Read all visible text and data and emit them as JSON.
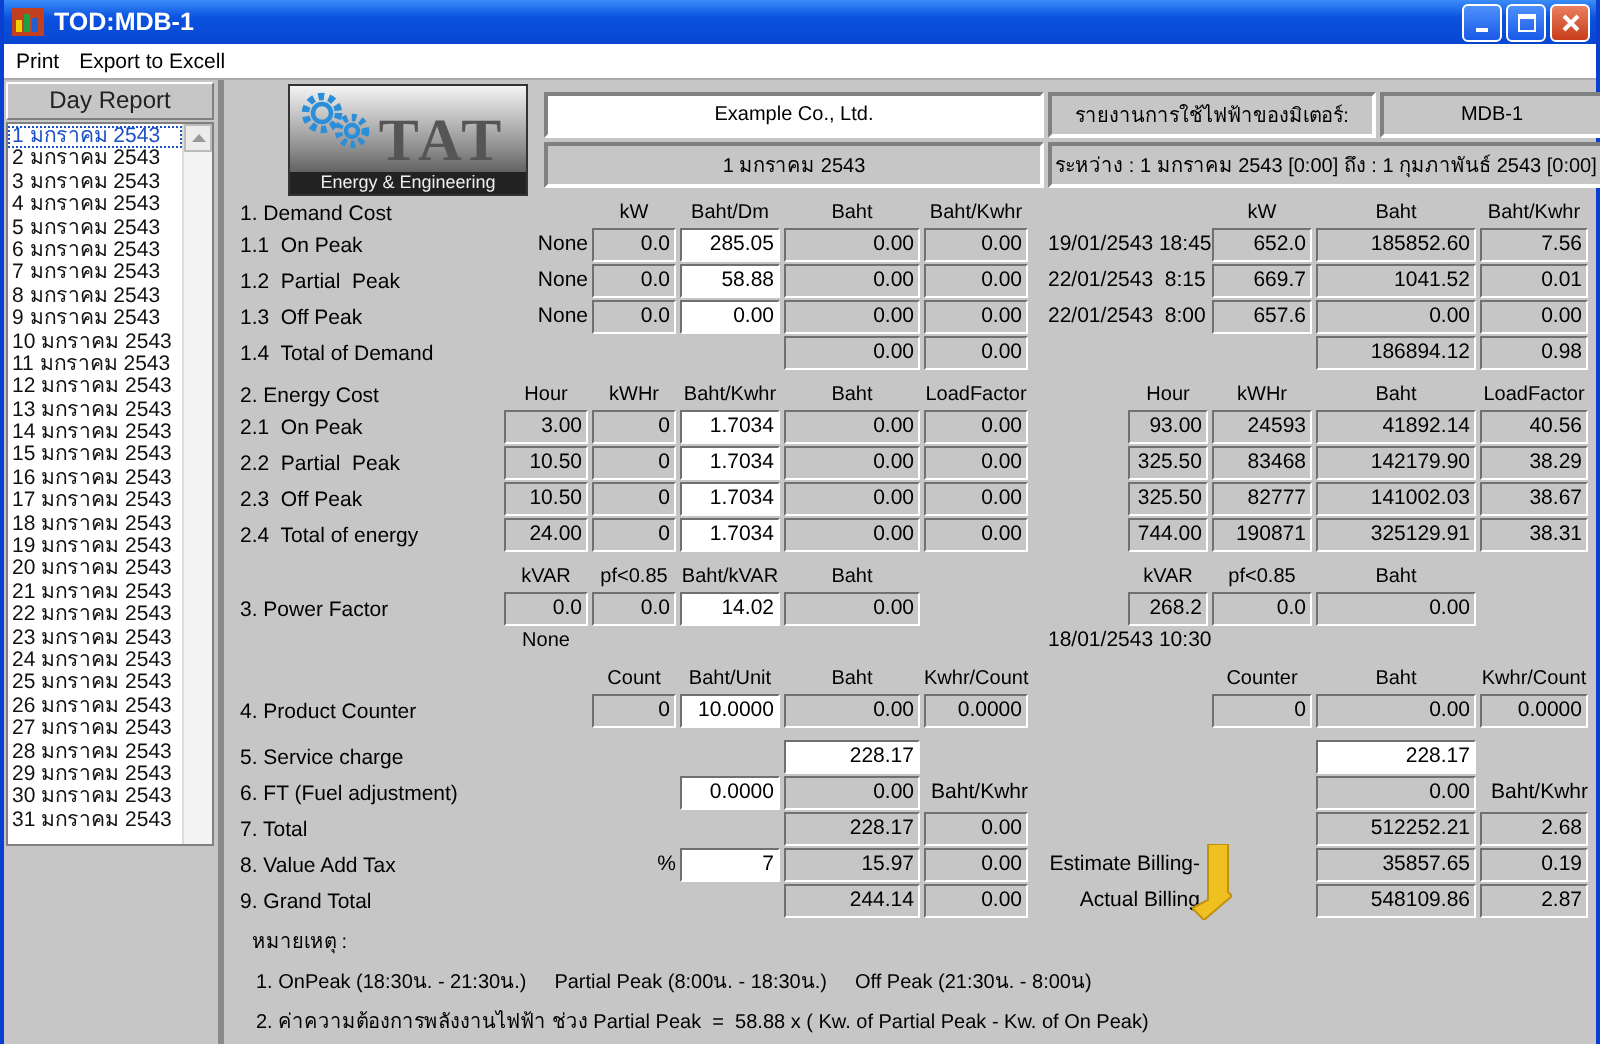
{
  "window": {
    "title": "TOD:MDB-1"
  },
  "menu": [
    "Print",
    "Export to Excell"
  ],
  "sidebar": {
    "title": "Day Report",
    "days": [
      {
        "label": "1 มกราคม 2543",
        "selected": true
      },
      {
        "label": "2 มกราคม 2543",
        "selected": false
      },
      {
        "label": "3 มกราคม 2543",
        "selected": false
      },
      {
        "label": "4 มกราคม 2543",
        "selected": false
      },
      {
        "label": "5 มกราคม 2543",
        "selected": false
      },
      {
        "label": "6 มกราคม 2543",
        "selected": false
      },
      {
        "label": "7 มกราคม 2543",
        "selected": false
      },
      {
        "label": "8 มกราคม 2543",
        "selected": false
      },
      {
        "label": "9 มกราคม 2543",
        "selected": false
      },
      {
        "label": "10 มกราคม 2543",
        "selected": false
      },
      {
        "label": "11 มกราคม 2543",
        "selected": false
      },
      {
        "label": "12 มกราคม 2543",
        "selected": false
      },
      {
        "label": "13 มกราคม 2543",
        "selected": false
      },
      {
        "label": "14 มกราคม 2543",
        "selected": false
      },
      {
        "label": "15 มกราคม 2543",
        "selected": false
      },
      {
        "label": "16 มกราคม 2543",
        "selected": false
      },
      {
        "label": "17 มกราคม 2543",
        "selected": false
      },
      {
        "label": "18 มกราคม 2543",
        "selected": false
      },
      {
        "label": "19 มกราคม 2543",
        "selected": false
      },
      {
        "label": "20 มกราคม 2543",
        "selected": false
      },
      {
        "label": "21 มกราคม 2543",
        "selected": false
      },
      {
        "label": "22 มกราคม 2543",
        "selected": false
      },
      {
        "label": "23 มกราคม 2543",
        "selected": false
      },
      {
        "label": "24 มกราคม 2543",
        "selected": false
      },
      {
        "label": "25 มกราคม 2543",
        "selected": false
      },
      {
        "label": "26 มกราคม 2543",
        "selected": false
      },
      {
        "label": "27 มกราคม 2543",
        "selected": false
      },
      {
        "label": "28 มกราคม 2543",
        "selected": false
      },
      {
        "label": "29 มกราคม 2543",
        "selected": false
      },
      {
        "label": "30 มกราคม 2543",
        "selected": false
      },
      {
        "label": "31 มกราคม 2543",
        "selected": false
      }
    ]
  },
  "logo": {
    "text": "TAT",
    "tagline": "Energy & Engineering"
  },
  "header": {
    "company": "Example Co., Ltd.",
    "date": "1 มกราคม 2543",
    "report_title": "รายงานการใช้ไฟฟ้าของมิเตอร์:",
    "meter": "MDB-1",
    "range": "ระหว่าง : 1 มกราคม 2543 [0:00] ถึง : 1 กุมภาพันธ์ 2543 [0:00]"
  },
  "sections": [
    {
      "rows": [
        {
          "kind": "header",
          "label": "1. Demand Cost",
          "left": [
            {
              "kind": "blank"
            },
            {
              "kind": "head",
              "text": "kW"
            },
            {
              "kind": "head",
              "text": "Baht/Dm"
            },
            {
              "kind": "head",
              "text": "Baht"
            },
            {
              "kind": "head",
              "text": "Baht/Kwhr"
            }
          ],
          "right": [
            {
              "kind": "blank"
            },
            {
              "kind": "blank"
            },
            {
              "kind": "head",
              "text": "kW"
            },
            {
              "kind": "head",
              "text": "Baht"
            },
            {
              "kind": "head",
              "text": "Baht/Kwhr"
            }
          ]
        },
        {
          "kind": "data",
          "label": "1.1  On Peak",
          "left": [
            {
              "kind": "text",
              "text": "None"
            },
            {
              "kind": "box",
              "text": "0.0"
            },
            {
              "kind": "input",
              "text": "285.05"
            },
            {
              "kind": "box",
              "text": "0.00"
            },
            {
              "kind": "box",
              "text": "0.00"
            }
          ],
          "right": [
            {
              "kind": "wide",
              "text": "19/01/2543 18:45"
            },
            {
              "kind": "box",
              "text": "652.0"
            },
            {
              "kind": "box",
              "text": "185852.60"
            },
            {
              "kind": "box",
              "text": "7.56"
            }
          ]
        },
        {
          "kind": "data",
          "label": "1.2  Partial  Peak",
          "left": [
            {
              "kind": "text",
              "text": "None"
            },
            {
              "kind": "box",
              "text": "0.0"
            },
            {
              "kind": "input",
              "text": "58.88"
            },
            {
              "kind": "box",
              "text": "0.00"
            },
            {
              "kind": "box",
              "text": "0.00"
            }
          ],
          "right": [
            {
              "kind": "wide",
              "text": "22/01/2543  8:15"
            },
            {
              "kind": "box",
              "text": "669.7"
            },
            {
              "kind": "box",
              "text": "1041.52"
            },
            {
              "kind": "box",
              "text": "0.01"
            }
          ]
        },
        {
          "kind": "data",
          "label": "1.3  Off Peak",
          "left": [
            {
              "kind": "text",
              "text": "None"
            },
            {
              "kind": "box",
              "text": "0.0"
            },
            {
              "kind": "input",
              "text": "0.00"
            },
            {
              "kind": "box",
              "text": "0.00"
            },
            {
              "kind": "box",
              "text": "0.00"
            }
          ],
          "right": [
            {
              "kind": "wide",
              "text": "22/01/2543  8:00"
            },
            {
              "kind": "box",
              "text": "657.6"
            },
            {
              "kind": "box",
              "text": "0.00"
            },
            {
              "kind": "box",
              "text": "0.00"
            }
          ]
        },
        {
          "kind": "data",
          "label": "1.4  Total of Demand",
          "left": [
            {
              "kind": "blank"
            },
            {
              "kind": "blank"
            },
            {
              "kind": "blank"
            },
            {
              "kind": "box",
              "text": "0.00"
            },
            {
              "kind": "box",
              "text": "0.00"
            }
          ],
          "right": [
            {
              "kind": "blank"
            },
            {
              "kind": "blank"
            },
            {
              "kind": "blank"
            },
            {
              "kind": "box",
              "text": "186894.12"
            },
            {
              "kind": "box",
              "text": "0.98"
            }
          ]
        }
      ]
    },
    {
      "rows": [
        {
          "kind": "header",
          "label": "2. Energy Cost",
          "left": [
            {
              "kind": "head",
              "text": "Hour"
            },
            {
              "kind": "head",
              "text": "kWHr"
            },
            {
              "kind": "head",
              "text": "Baht/Kwhr"
            },
            {
              "kind": "head",
              "text": "Baht"
            },
            {
              "kind": "head",
              "text": "LoadFactor"
            }
          ],
          "right": [
            {
              "kind": "blank"
            },
            {
              "kind": "head",
              "text": "Hour"
            },
            {
              "kind": "head",
              "text": "kWHr"
            },
            {
              "kind": "head",
              "text": "Baht"
            },
            {
              "kind": "head",
              "text": "LoadFactor"
            }
          ]
        },
        {
          "kind": "data",
          "label": "2.1  On Peak",
          "left": [
            {
              "kind": "box",
              "text": "3.00"
            },
            {
              "kind": "box",
              "text": "0"
            },
            {
              "kind": "input",
              "text": "1.7034"
            },
            {
              "kind": "box",
              "text": "0.00"
            },
            {
              "kind": "box",
              "text": "0.00"
            }
          ],
          "right": [
            {
              "kind": "blank"
            },
            {
              "kind": "box",
              "text": "93.00"
            },
            {
              "kind": "box",
              "text": "24593"
            },
            {
              "kind": "box",
              "text": "41892.14"
            },
            {
              "kind": "box",
              "text": "40.56"
            }
          ]
        },
        {
          "kind": "data",
          "label": "2.2  Partial  Peak",
          "left": [
            {
              "kind": "box",
              "text": "10.50"
            },
            {
              "kind": "box",
              "text": "0"
            },
            {
              "kind": "input",
              "text": "1.7034"
            },
            {
              "kind": "box",
              "text": "0.00"
            },
            {
              "kind": "box",
              "text": "0.00"
            }
          ],
          "right": [
            {
              "kind": "blank"
            },
            {
              "kind": "box",
              "text": "325.50"
            },
            {
              "kind": "box",
              "text": "83468"
            },
            {
              "kind": "box",
              "text": "142179.90"
            },
            {
              "kind": "box",
              "text": "38.29"
            }
          ]
        },
        {
          "kind": "data",
          "label": "2.3  Off Peak",
          "left": [
            {
              "kind": "box",
              "text": "10.50"
            },
            {
              "kind": "box",
              "text": "0"
            },
            {
              "kind": "input",
              "text": "1.7034"
            },
            {
              "kind": "box",
              "text": "0.00"
            },
            {
              "kind": "box",
              "text": "0.00"
            }
          ],
          "right": [
            {
              "kind": "blank"
            },
            {
              "kind": "box",
              "text": "325.50"
            },
            {
              "kind": "box",
              "text": "82777"
            },
            {
              "kind": "box",
              "text": "141002.03"
            },
            {
              "kind": "box",
              "text": "38.67"
            }
          ]
        },
        {
          "kind": "data",
          "label": "2.4  Total of energy",
          "left": [
            {
              "kind": "box",
              "text": "24.00"
            },
            {
              "kind": "box",
              "text": "0"
            },
            {
              "kind": "input",
              "text": "1.7034"
            },
            {
              "kind": "box",
              "text": "0.00"
            },
            {
              "kind": "box",
              "text": "0.00"
            }
          ],
          "right": [
            {
              "kind": "blank"
            },
            {
              "kind": "box",
              "text": "744.00"
            },
            {
              "kind": "box",
              "text": "190871"
            },
            {
              "kind": "box",
              "text": "325129.91"
            },
            {
              "kind": "box",
              "text": "38.31"
            }
          ]
        }
      ]
    },
    {
      "rows": [
        {
          "kind": "header",
          "left": [
            {
              "kind": "head",
              "text": "kVAR"
            },
            {
              "kind": "head",
              "text": "pf<0.85"
            },
            {
              "kind": "head",
              "text": "Baht/kVAR"
            },
            {
              "kind": "head",
              "text": "Baht"
            },
            {
              "kind": "blank"
            }
          ],
          "right": [
            {
              "kind": "blank"
            },
            {
              "kind": "head",
              "text": "kVAR"
            },
            {
              "kind": "head",
              "text": "pf<0.85"
            },
            {
              "kind": "head",
              "text": "Baht"
            },
            {
              "kind": "blank"
            }
          ]
        },
        {
          "kind": "data",
          "label": "3. Power Factor",
          "left": [
            {
              "kind": "box",
              "text": "0.0"
            },
            {
              "kind": "box",
              "text": "0.0"
            },
            {
              "kind": "input",
              "text": "14.02"
            },
            {
              "kind": "box",
              "text": "0.00"
            },
            {
              "kind": "blank"
            }
          ],
          "right": [
            {
              "kind": "blank"
            },
            {
              "kind": "box",
              "text": "268.2"
            },
            {
              "kind": "box",
              "text": "0.0"
            },
            {
              "kind": "box",
              "text": "0.00"
            },
            {
              "kind": "blank"
            }
          ]
        },
        {
          "kind": "header",
          "left": [
            {
              "kind": "head",
              "text": "None"
            },
            {
              "kind": "blank"
            },
            {
              "kind": "blank"
            },
            {
              "kind": "blank"
            },
            {
              "kind": "blank"
            }
          ],
          "right": [
            {
              "kind": "wide",
              "text": "18/01/2543 10:30"
            },
            {
              "kind": "blank"
            },
            {
              "kind": "blank"
            },
            {
              "kind": "blank"
            }
          ]
        }
      ]
    },
    {
      "rows": [
        {
          "kind": "header",
          "left": [
            {
              "kind": "blank"
            },
            {
              "kind": "head",
              "text": "Count"
            },
            {
              "kind": "head",
              "text": "Baht/Unit"
            },
            {
              "kind": "head",
              "text": "Baht"
            },
            {
              "kind": "head",
              "text": "Kwhr/Count"
            }
          ],
          "right": [
            {
              "kind": "blank"
            },
            {
              "kind": "blank"
            },
            {
              "kind": "head",
              "text": "Counter"
            },
            {
              "kind": "head",
              "text": "Baht"
            },
            {
              "kind": "head",
              "text": "Kwhr/Count"
            }
          ]
        },
        {
          "kind": "data",
          "label": "4. Product Counter",
          "left": [
            {
              "kind": "blank"
            },
            {
              "kind": "box",
              "text": "0"
            },
            {
              "kind": "input",
              "text": "10.0000"
            },
            {
              "kind": "box",
              "text": "0.00"
            },
            {
              "kind": "box",
              "text": "0.0000"
            }
          ],
          "right": [
            {
              "kind": "blank"
            },
            {
              "kind": "blank"
            },
            {
              "kind": "box",
              "text": "0"
            },
            {
              "kind": "box",
              "text": "0.00"
            },
            {
              "kind": "box",
              "text": "0.0000"
            }
          ]
        }
      ]
    },
    {
      "rows": [
        {
          "kind": "data",
          "label": "5. Service charge",
          "left": [
            {
              "kind": "blank"
            },
            {
              "kind": "blank"
            },
            {
              "kind": "blank"
            },
            {
              "kind": "input",
              "text": "228.17"
            },
            {
              "kind": "blank"
            }
          ],
          "right": [
            {
              "kind": "blank"
            },
            {
              "kind": "blank"
            },
            {
              "kind": "blank"
            },
            {
              "kind": "input",
              "text": "228.17"
            },
            {
              "kind": "blank"
            }
          ]
        },
        {
          "kind": "data",
          "label": "6. FT (Fuel adjustment)",
          "left": [
            {
              "kind": "blank"
            },
            {
              "kind": "blank"
            },
            {
              "kind": "input",
              "text": "0.0000"
            },
            {
              "kind": "box",
              "text": "0.00"
            },
            {
              "kind": "text",
              "text": "Baht/Kwhr"
            }
          ],
          "right": [
            {
              "kind": "blank"
            },
            {
              "kind": "blank"
            },
            {
              "kind": "blank"
            },
            {
              "kind": "box",
              "text": "0.00"
            },
            {
              "kind": "text",
              "text": "Baht/Kwhr"
            }
          ]
        },
        {
          "kind": "data",
          "label": "7. Total",
          "left": [
            {
              "kind": "blank"
            },
            {
              "kind": "blank"
            },
            {
              "kind": "blank"
            },
            {
              "kind": "box",
              "text": "228.17"
            },
            {
              "kind": "box",
              "text": "0.00"
            }
          ],
          "right": [
            {
              "kind": "blank"
            },
            {
              "kind": "blank"
            },
            {
              "kind": "blank"
            },
            {
              "kind": "box",
              "text": "512252.21"
            },
            {
              "kind": "box",
              "text": "2.68"
            }
          ]
        },
        {
          "kind": "data",
          "label": "8. Value Add Tax",
          "left": [
            {
              "kind": "blank"
            },
            {
              "kind": "text",
              "text": "%"
            },
            {
              "kind": "input",
              "text": "7"
            },
            {
              "kind": "box",
              "text": "15.97"
            },
            {
              "kind": "box",
              "text": "0.00"
            }
          ],
          "right": [
            {
              "kind": "wide",
              "text": "Estimate Billing-"
            },
            {
              "kind": "arrow"
            },
            {
              "kind": "box",
              "text": "35857.65"
            },
            {
              "kind": "box",
              "text": "0.19"
            }
          ]
        },
        {
          "kind": "data",
          "label": "9. Grand Total",
          "left": [
            {
              "kind": "blank"
            },
            {
              "kind": "blank"
            },
            {
              "kind": "blank"
            },
            {
              "kind": "box",
              "text": "244.14"
            },
            {
              "kind": "box",
              "text": "0.00"
            }
          ],
          "right": [
            {
              "kind": "wide",
              "text": "Actual Billing"
            },
            {
              "kind": "blank"
            },
            {
              "kind": "box",
              "text": "548109.86"
            },
            {
              "kind": "box",
              "text": "2.87"
            }
          ]
        }
      ]
    }
  ],
  "notes": {
    "title": "หมายเหตุ :",
    "lines": [
      [
        "1. OnPeak (18:30น. - 21:30น.)",
        "Partial Peak (8:00น. - 18:30น.)",
        "Off Peak (21:30น. - 8:00น)"
      ],
      [
        "2. ค่าความต้องการพลังงานไฟฟ้า ช่วง Partial Peak  =  58.88 x ( Kw. of Partial Peak - Kw. of On Peak)"
      ]
    ]
  }
}
